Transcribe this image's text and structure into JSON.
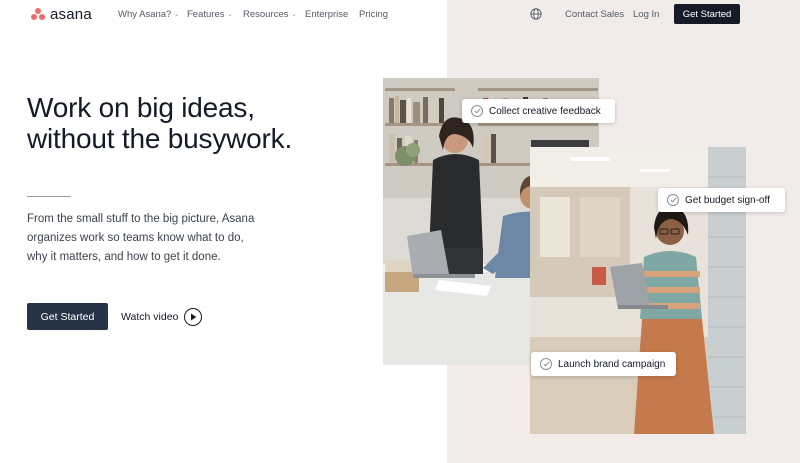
{
  "brand": {
    "name": "asana",
    "logo_color": "#f06a6a"
  },
  "nav": {
    "items": [
      {
        "label": "Why Asana?",
        "has_dropdown": true
      },
      {
        "label": "Features",
        "has_dropdown": true
      },
      {
        "label": "Resources",
        "has_dropdown": true
      },
      {
        "label": "Enterprise",
        "has_dropdown": false
      },
      {
        "label": "Pricing",
        "has_dropdown": false
      }
    ],
    "globe_icon": "globe-icon",
    "contact_sales": "Contact Sales",
    "log_in": "Log In",
    "cta": "Get Started"
  },
  "hero": {
    "headline": [
      "Work on big ideas,",
      "without the busywork."
    ],
    "subtext": [
      "From the small stuff to the big picture, Asana",
      "organizes work so teams know what to do,",
      "why it matters, and how to get it done."
    ],
    "cta": "Get Started",
    "watch_video": "Watch video",
    "play_icon": "play-icon"
  },
  "tags": [
    {
      "label": "Collect creative feedback"
    },
    {
      "label": "Get budget sign-off"
    },
    {
      "label": "Launch brand campaign"
    }
  ],
  "colors": {
    "dark": "#151b26",
    "cta_dark": "#273347",
    "panel_beige": "#f1ecea",
    "brand_coral": "#f06a6a"
  }
}
